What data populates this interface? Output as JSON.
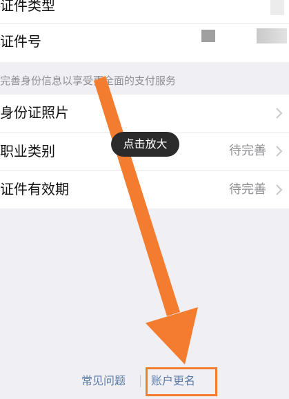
{
  "rows": {
    "id_type": {
      "label": "证件类型"
    },
    "id_number": {
      "label": "证件号"
    },
    "id_photo": {
      "label": "身份证照片"
    },
    "occupation": {
      "label": "职业类别",
      "value": "待完善"
    },
    "validity": {
      "label": "证件有效期",
      "value": "待完善"
    }
  },
  "hint": "完善身份信息以享受更全面的支付服务",
  "tooltip": "点击放大",
  "footer": {
    "faq": "常见问题",
    "rename": "账户更名"
  },
  "colors": {
    "annotation_orange": "#f47c2f",
    "link_blue": "#5b7aa6"
  },
  "icons": {
    "chevron": "chevron-right-icon",
    "annotation": "orange-arrow-icon"
  }
}
